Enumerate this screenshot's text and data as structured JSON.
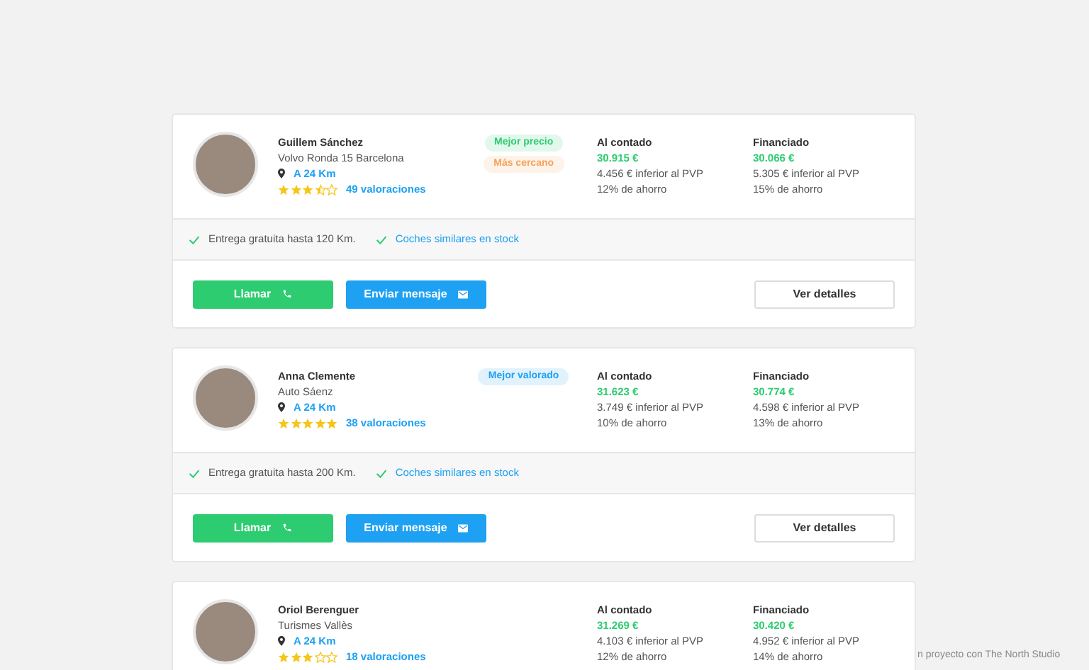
{
  "dealers": [
    {
      "name": "Guillem Sánchez",
      "dealership": "Volvo Ronda 15 Barcelona",
      "distance": "A 24 Km",
      "stars": 3.5,
      "reviews": "49 valoraciones",
      "badges": [
        {
          "label": "Mejor precio",
          "color": "#2ecc71"
        },
        {
          "label": "Más cercano",
          "color": "#f5a25d"
        }
      ],
      "prices": [
        {
          "heading": "Al contado",
          "price": "30.915 €",
          "saving": "4.456 € inferior al PVP",
          "percent": "12% de ahorro"
        },
        {
          "heading": "Financiado",
          "price": "30.066 €",
          "saving": "5.305 € inferior al PVP",
          "percent": "15% de ahorro"
        }
      ],
      "features": [
        {
          "kind": "text",
          "label": "Entrega gratuita hasta 120 Km."
        },
        {
          "kind": "link",
          "label": "Coches similares en stock"
        }
      ],
      "actions": [
        {
          "kind": "call",
          "label": "Llamar"
        },
        {
          "kind": "message",
          "label": "Enviar mensaje"
        },
        {
          "kind": "details",
          "label": "Ver detalles"
        }
      ]
    },
    {
      "name": "Anna Clemente",
      "dealership": "Auto Sáenz",
      "distance": "A 24 Km",
      "stars": 5,
      "reviews": "38 valoraciones",
      "badges": [
        {
          "label": "Mejor valorado",
          "color": "#1ea1f2"
        }
      ],
      "prices": [
        {
          "heading": "Al contado",
          "price": "31.623 €",
          "saving": "3.749 € inferior al PVP",
          "percent": "10% de ahorro"
        },
        {
          "heading": "Financiado",
          "price": "30.774 €",
          "saving": "4.598 € inferior al PVP",
          "percent": "13% de ahorro"
        }
      ],
      "features": [
        {
          "kind": "text",
          "label": "Entrega gratuita hasta 200 Km."
        },
        {
          "kind": "link",
          "label": "Coches similares en stock"
        }
      ],
      "actions": [
        {
          "kind": "call",
          "label": "Llamar"
        },
        {
          "kind": "message",
          "label": "Enviar mensaje"
        },
        {
          "kind": "details",
          "label": "Ver detalles"
        }
      ]
    },
    {
      "name": "Oriol Berenguer",
      "dealership": "Turismes Vallès",
      "distance": "A 24 Km",
      "stars": 3,
      "reviews": "18 valoraciones",
      "prices": [
        {
          "heading": "Al contado",
          "price": "31.269 €",
          "saving": "4.103 € inferior al PVP",
          "percent": "12% de ahorro"
        },
        {
          "heading": "Financiado",
          "price": "30.420 €",
          "saving": "4.952 € inferior al PVP",
          "percent": "14% de ahorro"
        }
      ]
    }
  ],
  "credit": "n proyecto con The North Studio"
}
